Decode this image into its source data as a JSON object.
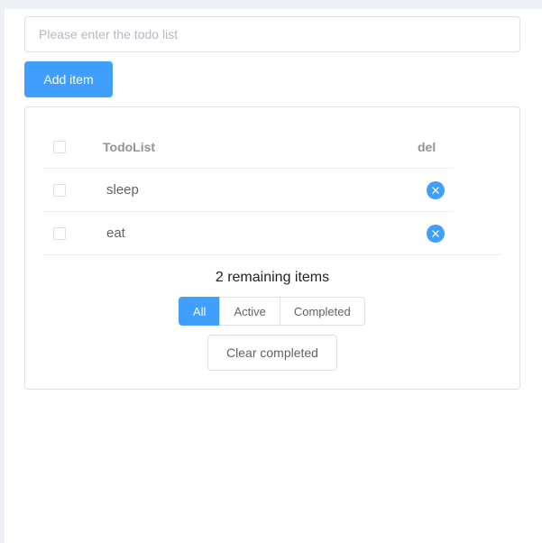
{
  "input": {
    "placeholder": "Please enter the todo list",
    "value": ""
  },
  "add_button": {
    "label": "Add item"
  },
  "table": {
    "headers": {
      "todo": "TodoList",
      "del": "del"
    },
    "items": [
      {
        "text": "sleep",
        "checked": false
      },
      {
        "text": "eat",
        "checked": false
      }
    ]
  },
  "footer": {
    "remaining": "2 remaining items",
    "filters": [
      "All",
      "Active",
      "Completed"
    ],
    "active_filter": "All",
    "clear_label": "Clear completed"
  },
  "colors": {
    "accent": "#409eff",
    "border": "#dcdfe6"
  },
  "icons": {
    "delete": "close-icon",
    "checkbox": "checkbox-icon"
  }
}
